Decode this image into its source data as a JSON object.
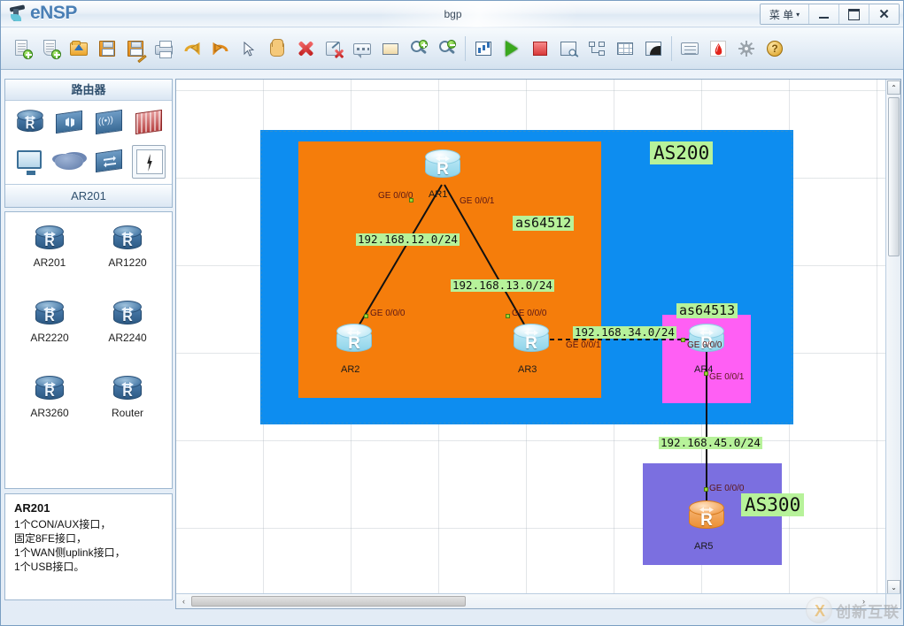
{
  "window": {
    "app_name": "eNSP",
    "title": "bgp",
    "menu_label": "菜 单",
    "minimize_label": "Minimize",
    "maximize_label": "Maximize",
    "close_label": "Close"
  },
  "toolbar": {
    "buttons": [
      {
        "name": "new-topology",
        "icon": "new-document-icon",
        "tip": "新建"
      },
      {
        "name": "open-topology",
        "icon": "open-document-icon",
        "tip": "打开"
      },
      {
        "name": "open-folder",
        "icon": "folder-open-icon",
        "tip": "打开文件夹"
      },
      {
        "name": "save",
        "icon": "save-icon",
        "tip": "保存"
      },
      {
        "name": "save-as",
        "icon": "save-as-icon",
        "tip": "另存为"
      },
      {
        "name": "print",
        "icon": "printer-icon",
        "tip": "打印"
      },
      {
        "name": "undo",
        "icon": "undo-arrow-icon",
        "tip": "撤销"
      },
      {
        "name": "redo",
        "icon": "redo-arrow-icon",
        "tip": "重做"
      },
      {
        "name": "select-tool",
        "icon": "cursor-arrow-icon",
        "tip": "选择"
      },
      {
        "name": "pan-tool",
        "icon": "hand-icon",
        "tip": "移动"
      },
      {
        "name": "delete",
        "icon": "red-x-icon",
        "tip": "删除"
      },
      {
        "name": "delete-link",
        "icon": "delete-link-icon",
        "tip": "删除连线"
      },
      {
        "name": "add-text",
        "icon": "text-note-icon",
        "tip": "添加文本"
      },
      {
        "name": "add-shape",
        "icon": "rectangle-shape-icon",
        "tip": "添加图形"
      },
      {
        "name": "zoom-in",
        "icon": "magnifier-plus-icon",
        "tip": "放大"
      },
      {
        "name": "zoom-out",
        "icon": "magnifier-minus-icon",
        "tip": "缩小"
      },
      {
        "name": "show-chart",
        "icon": "chart-icon",
        "tip": "统计"
      },
      {
        "name": "start-all",
        "icon": "play-green-icon",
        "tip": "开启设备"
      },
      {
        "name": "stop-all",
        "icon": "stop-red-icon",
        "tip": "关闭设备"
      },
      {
        "name": "capture",
        "icon": "capture-screen-icon",
        "tip": "数据抓包"
      },
      {
        "name": "topology-view",
        "icon": "topology-icon",
        "tip": "拓扑"
      },
      {
        "name": "grid-toggle",
        "icon": "grid-icon",
        "tip": "网格"
      },
      {
        "name": "export-image",
        "icon": "export-image-icon",
        "tip": "导出"
      },
      {
        "name": "comment",
        "icon": "speech-bubble-icon",
        "tip": "注释"
      },
      {
        "name": "huawei-home",
        "icon": "huawei-logo-icon",
        "tip": "华为"
      },
      {
        "name": "settings",
        "icon": "gear-icon",
        "tip": "设置"
      },
      {
        "name": "help",
        "icon": "help-circle-icon",
        "tip": "帮助"
      }
    ]
  },
  "sidebar": {
    "panel_title": "路由器",
    "selected_type": "AR201",
    "device_types": [
      {
        "name": "router-type",
        "icon": "router-icon",
        "selected": false
      },
      {
        "name": "switch-type",
        "icon": "switch-icon",
        "selected": false
      },
      {
        "name": "wlan-type",
        "icon": "wireless-ap-icon",
        "selected": false
      },
      {
        "name": "firewall-type",
        "icon": "firewall-icon",
        "selected": false
      },
      {
        "name": "endpoint-type",
        "icon": "pc-monitor-icon",
        "selected": false
      },
      {
        "name": "cloud-type",
        "icon": "cloud-icon",
        "selected": false
      },
      {
        "name": "lan-switch-type",
        "icon": "lan-switch-icon",
        "selected": false
      },
      {
        "name": "connection-type",
        "icon": "lightning-connection-icon",
        "selected": true
      }
    ],
    "devices": [
      {
        "name": "AR201"
      },
      {
        "name": "AR1220"
      },
      {
        "name": "AR2220"
      },
      {
        "name": "AR2240"
      },
      {
        "name": "AR3260"
      },
      {
        "name": "Router"
      }
    ],
    "description": {
      "title": "AR201",
      "lines": [
        "1个CON/AUX接口，",
        "固定8FE接口，",
        "1个WAN侧uplink接口，",
        "1个USB接口。"
      ]
    }
  },
  "canvas": {
    "zones": [
      {
        "name": "zone-as200",
        "label": "AS200",
        "color": "#0d8df0",
        "selected": true
      },
      {
        "name": "zone-as64512",
        "label": "as64512",
        "color": "#f57d0b",
        "selected": false
      },
      {
        "name": "zone-as64513",
        "label": "as64513",
        "color": "#ff5ff4",
        "selected": false
      },
      {
        "name": "zone-as300",
        "label": "AS300",
        "color": "#7b6fe0",
        "selected": false
      }
    ],
    "routers": [
      {
        "name": "AR1",
        "state": "stopped"
      },
      {
        "name": "AR2",
        "state": "stopped"
      },
      {
        "name": "AR3",
        "state": "stopped"
      },
      {
        "name": "AR4",
        "state": "stopped"
      },
      {
        "name": "AR5",
        "state": "running"
      }
    ],
    "network_labels": [
      {
        "name": "net-192-168-12",
        "text": "192.168.12.0/24"
      },
      {
        "name": "net-192-168-13",
        "text": "192.168.13.0/24"
      },
      {
        "name": "net-192-168-34",
        "text": "192.168.34.0/24"
      },
      {
        "name": "net-192-168-45",
        "text": "192.168.45.0/24"
      }
    ],
    "interfaces": [
      {
        "name": "ar1-ge0-0-0",
        "text": "GE 0/0/0"
      },
      {
        "name": "ar1-ge0-0-1",
        "text": "GE 0/0/1"
      },
      {
        "name": "ar2-ge0-0-0",
        "text": "GE 0/0/0"
      },
      {
        "name": "ar3-ge0-0-0",
        "text": "GE 0/0/0"
      },
      {
        "name": "ar3-ge0-0-1",
        "text": "GE 0/0/1"
      },
      {
        "name": "ar4-ge0-0-0",
        "text": "GE 0/0/0"
      },
      {
        "name": "ar4-ge0-0-1",
        "text": "GE 0/0/1"
      },
      {
        "name": "ar5-ge0-0-0",
        "text": "GE 0/0/0"
      }
    ],
    "scroll": {
      "up_arrow": "⌃",
      "down_arrow": "⌄",
      "left_arrow": "‹",
      "right_arrow": "›"
    }
  },
  "watermark": {
    "text": "创新互联"
  }
}
